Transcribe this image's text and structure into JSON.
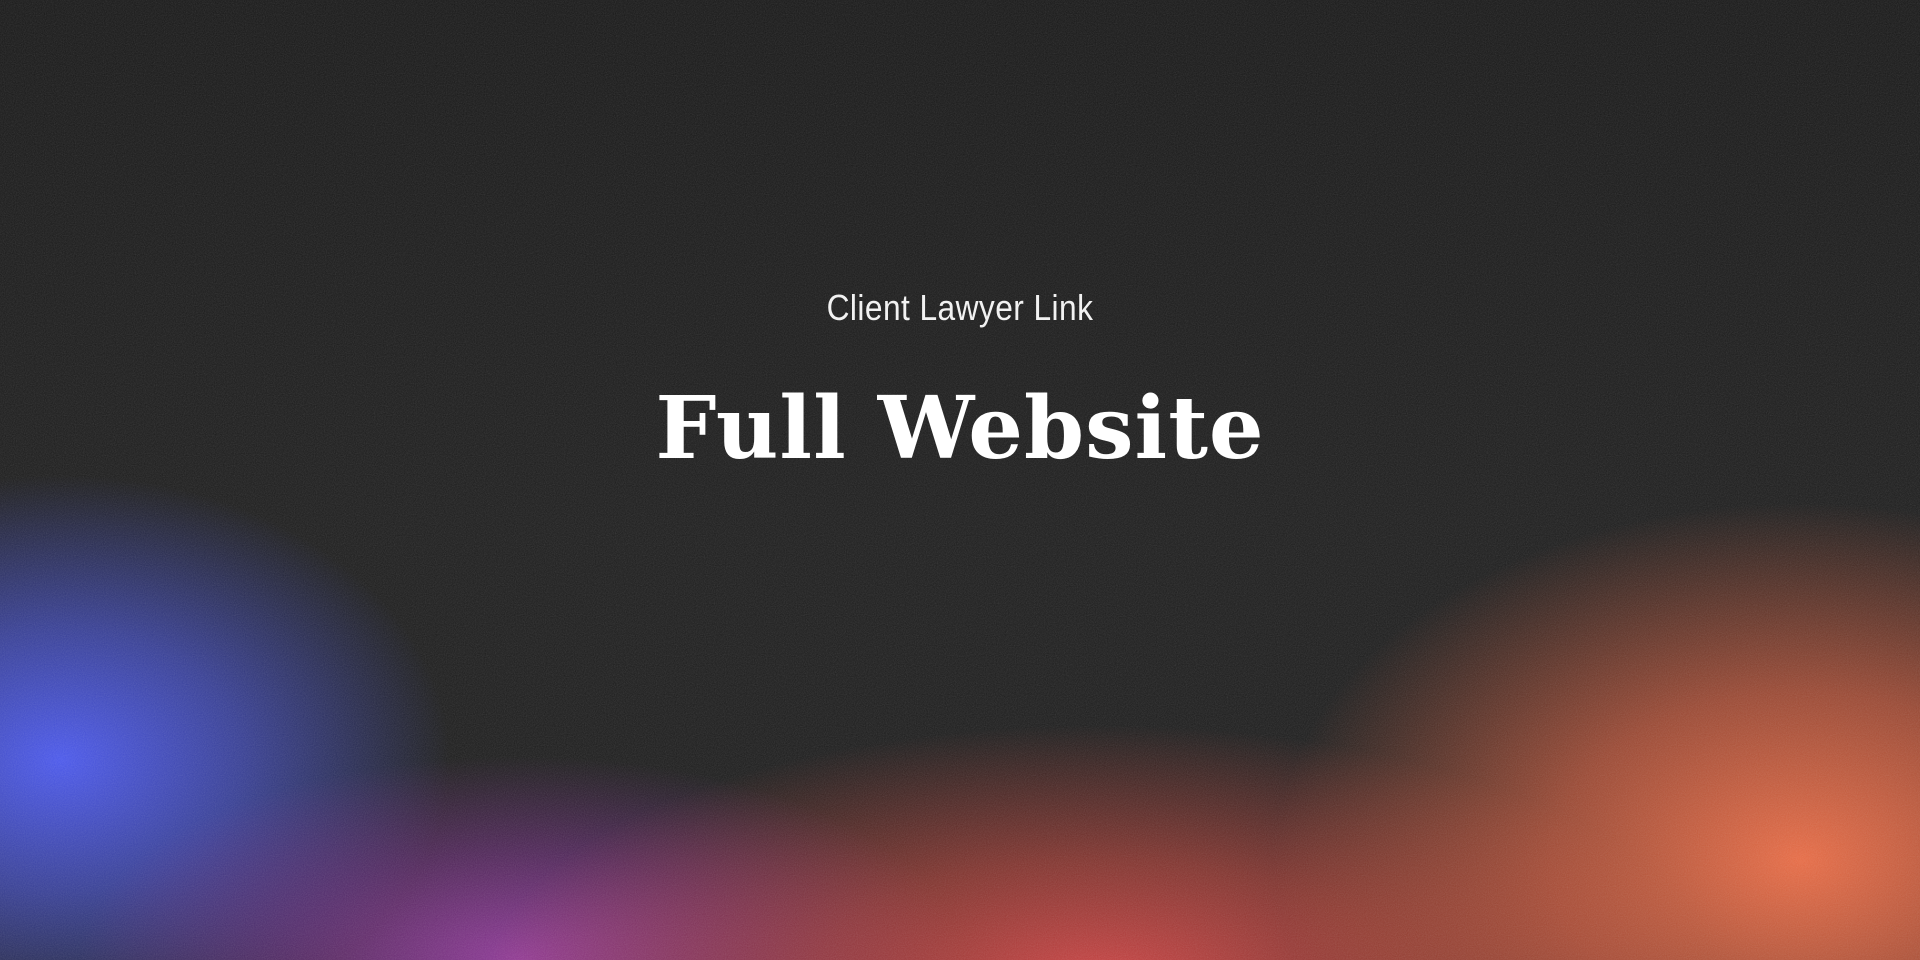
{
  "hero": {
    "subtitle": "Client Lawyer Link",
    "title": "Full Website"
  },
  "colors": {
    "background": "#1c1c1c",
    "glow_blue": "#4c5af5",
    "glow_purple": "#a03caa",
    "glow_red": "#dc4646",
    "glow_orange": "#f06e46",
    "text": "#ffffff"
  }
}
